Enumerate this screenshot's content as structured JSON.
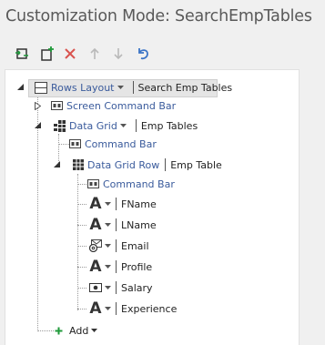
{
  "title": "Customization Mode: SearchEmpTables",
  "toolbar": {
    "buttons": [
      {
        "name": "wrap-icon-button"
      },
      {
        "name": "add-icon-button"
      },
      {
        "name": "delete-icon-button"
      },
      {
        "name": "move-up-icon-button"
      },
      {
        "name": "move-down-icon-button"
      },
      {
        "name": "undo-icon-button"
      }
    ]
  },
  "tree": {
    "root": {
      "layout": "Rows Layout",
      "label": "Search Emp Tables"
    },
    "screen_command_bar": "Screen Command Bar",
    "data_grid": {
      "type": "Data Grid",
      "label": "Emp Tables"
    },
    "grid_command_bar": "Command Bar",
    "data_grid_row": {
      "type": "Data Grid Row",
      "label": "Emp Table"
    },
    "row_command_bar": "Command Bar",
    "fields": [
      {
        "label": "FName",
        "icon": "text-a-icon"
      },
      {
        "label": "LName",
        "icon": "text-a-icon"
      },
      {
        "label": "Email",
        "icon": "email-icon"
      },
      {
        "label": "Profile",
        "icon": "text-a-icon"
      },
      {
        "label": "Salary",
        "icon": "money-icon"
      },
      {
        "label": "Experience",
        "icon": "text-a-icon"
      }
    ],
    "add_label": "Add"
  },
  "colors": {
    "accent_green": "#1f9a3a",
    "delete_red": "#d9534f",
    "link_blue": "#3a5b9c"
  }
}
